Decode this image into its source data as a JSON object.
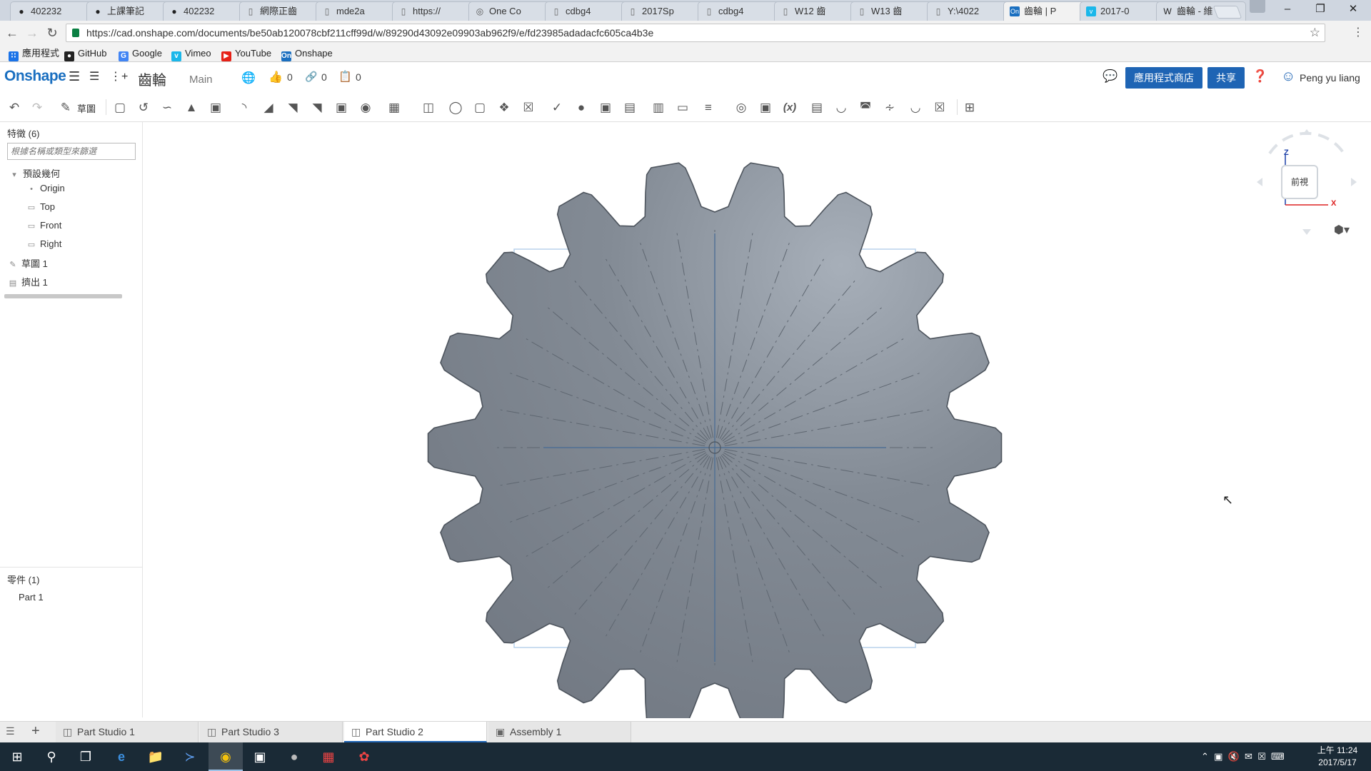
{
  "browser": {
    "tabs": [
      {
        "title": "402232",
        "icon": "github-icon"
      },
      {
        "title": "上課筆記",
        "icon": "github-icon"
      },
      {
        "title": "402232",
        "icon": "github-icon"
      },
      {
        "title": "網際正齒",
        "icon": "document-icon"
      },
      {
        "title": "mde2a",
        "icon": "document-icon"
      },
      {
        "title": "https://",
        "icon": "document-icon"
      },
      {
        "title": "One Co",
        "icon": "globe-icon"
      },
      {
        "title": "cdbg4",
        "icon": "document-icon"
      },
      {
        "title": "2017Sp",
        "icon": "document-icon"
      },
      {
        "title": "cdbg4",
        "icon": "document-icon"
      },
      {
        "title": "W12 齒",
        "icon": "document-icon"
      },
      {
        "title": "W13 齒",
        "icon": "document-icon"
      },
      {
        "title": "Y:\\4022",
        "icon": "document-icon"
      },
      {
        "title": "齒輪 | P",
        "icon": "onshape-icon",
        "active": true
      },
      {
        "title": "2017-0",
        "icon": "vimeo-icon"
      },
      {
        "title": "齒輪 - 維",
        "icon": "wikipedia-icon"
      }
    ],
    "url": "https://cad.onshape.com/documents/be50ab120078cbf211cff99d/w/89290d43092e09903ab962f9/e/fd23985adadacfc605ca4b3e",
    "bookmarks": [
      {
        "label": "應用程式",
        "icon": "apps-grid-icon",
        "color": "#1a73e8"
      },
      {
        "label": "GitHub",
        "icon": "github-icon",
        "color": "#222222"
      },
      {
        "label": "Google",
        "icon": "google-icon",
        "color": "#4285f4"
      },
      {
        "label": "Vimeo",
        "icon": "vimeo-icon",
        "color": "#1ab7ea"
      },
      {
        "label": "YouTube",
        "icon": "youtube-icon",
        "color": "#e62117"
      },
      {
        "label": "Onshape",
        "icon": "onshape-icon",
        "color": "#1a6fc0"
      }
    ]
  },
  "app": {
    "logo": "Onshape",
    "document_title": "齒輪",
    "workspace": "Main",
    "likes": "0",
    "links": "0",
    "copies": "0",
    "app_store_label": "應用程式商店",
    "share_label": "共享",
    "user_name": "Peng yu liang",
    "accent": "#1e64b4"
  },
  "toolbar": {
    "sketch_label": "草圖"
  },
  "feature_tree": {
    "header": "特徵 (6)",
    "filter_placeholder": "根據名稱或類型來篩選",
    "default_geometry": "預設幾何",
    "items": [
      "Origin",
      "Top",
      "Front",
      "Right"
    ],
    "sketch": "草圖 1",
    "extrude": "擠出 1"
  },
  "parts": {
    "header": "零件 (1)",
    "items": [
      "Part 1"
    ]
  },
  "viewcube": {
    "face": "前視",
    "axis_z": "Z",
    "axis_x": "X"
  },
  "model": {
    "gear_color": "#7d848e",
    "teeth": 18
  },
  "bottom_tabs": [
    {
      "label": "Part Studio 1"
    },
    {
      "label": "Part Studio 3"
    },
    {
      "label": "Part Studio 2",
      "active": true
    },
    {
      "label": "Assembly 1"
    }
  ],
  "taskbar": {
    "time": "上午 11:24",
    "date": "2017/5/17"
  }
}
